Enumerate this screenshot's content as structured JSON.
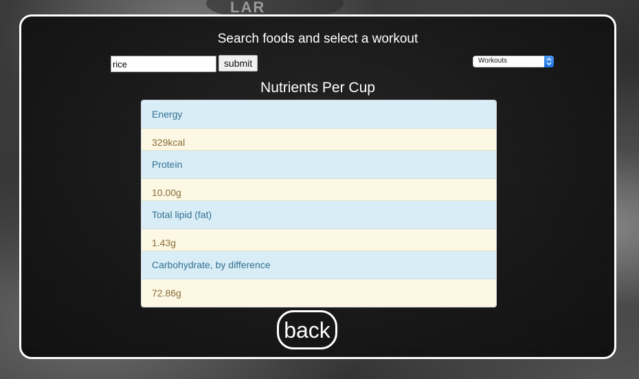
{
  "background": {
    "deco_text": "LAR"
  },
  "panel": {
    "heading": "Search foods and select a workout",
    "search": {
      "value": "rice",
      "placeholder": ""
    },
    "submit_label": "submit",
    "workouts_select": {
      "selected": "Workouts"
    },
    "subheading": "Nutrients Per Cup",
    "nutrients": [
      {
        "label": "Energy",
        "value": "329kcal"
      },
      {
        "label": "Protein",
        "value": "10.00g"
      },
      {
        "label": "Total lipid (fat)",
        "value": "1.43g"
      },
      {
        "label": "Carbohydrate, by difference",
        "value": "72.86g"
      }
    ],
    "back_label": "back"
  },
  "colors": {
    "panel_border": "#ffffff",
    "label_bg": "#d9edf7",
    "label_text": "#31708f",
    "value_bg": "#fcf8e3",
    "value_text": "#8a6d3b",
    "select_accent": "#1f6fe0"
  }
}
